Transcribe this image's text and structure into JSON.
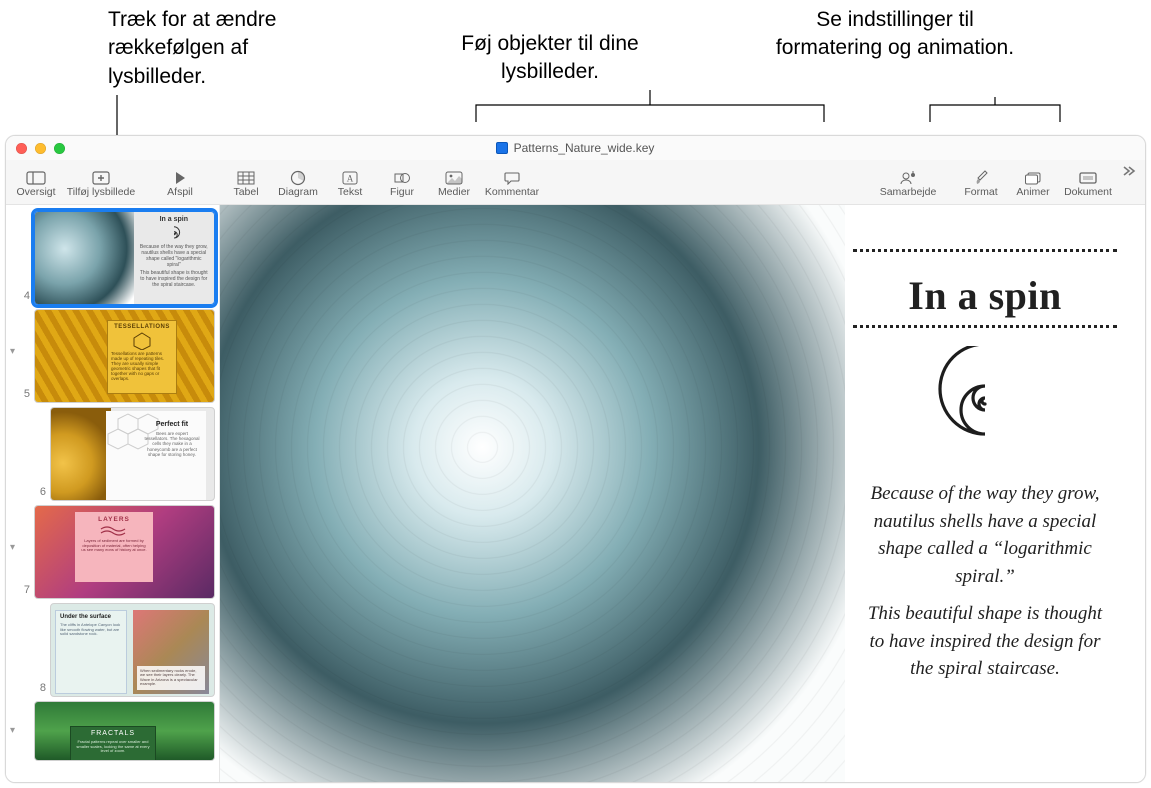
{
  "annotations": {
    "left": "Træk for at ændre rækkefølgen af lysbilleder.",
    "mid": "Føj objekter til dine lysbilleder.",
    "right": "Se indstillinger til formatering og animation."
  },
  "window": {
    "filename": "Patterns_Nature_wide.key"
  },
  "toolbar": {
    "oversigt": "Oversigt",
    "tilfoj": "Tilføj lysbillede",
    "afspil": "Afspil",
    "tabel": "Tabel",
    "diagram": "Diagram",
    "tekst": "Tekst",
    "figur": "Figur",
    "medier": "Medier",
    "kommentar": "Kommentar",
    "samarbejde": "Samarbejde",
    "format": "Format",
    "animer": "Animer",
    "dokument": "Dokument"
  },
  "sidebar": {
    "slides": [
      {
        "num": "4",
        "title": "In a spin",
        "selected": true
      },
      {
        "num": "5",
        "title": "TESSELLATIONS"
      },
      {
        "num": "6",
        "title": "Perfect fit"
      },
      {
        "num": "7",
        "title": "LAYERS"
      },
      {
        "num": "8",
        "title": "Under the surface"
      },
      {
        "num": "",
        "title": "FRACTALS"
      }
    ]
  },
  "slide": {
    "title": "In a spin",
    "p1": "Because of the way they grow, nautilus shells have a special shape called a “logarithmic spiral.”",
    "p2": "This beautiful shape is thought to have inspired the design for the spiral staircase."
  }
}
